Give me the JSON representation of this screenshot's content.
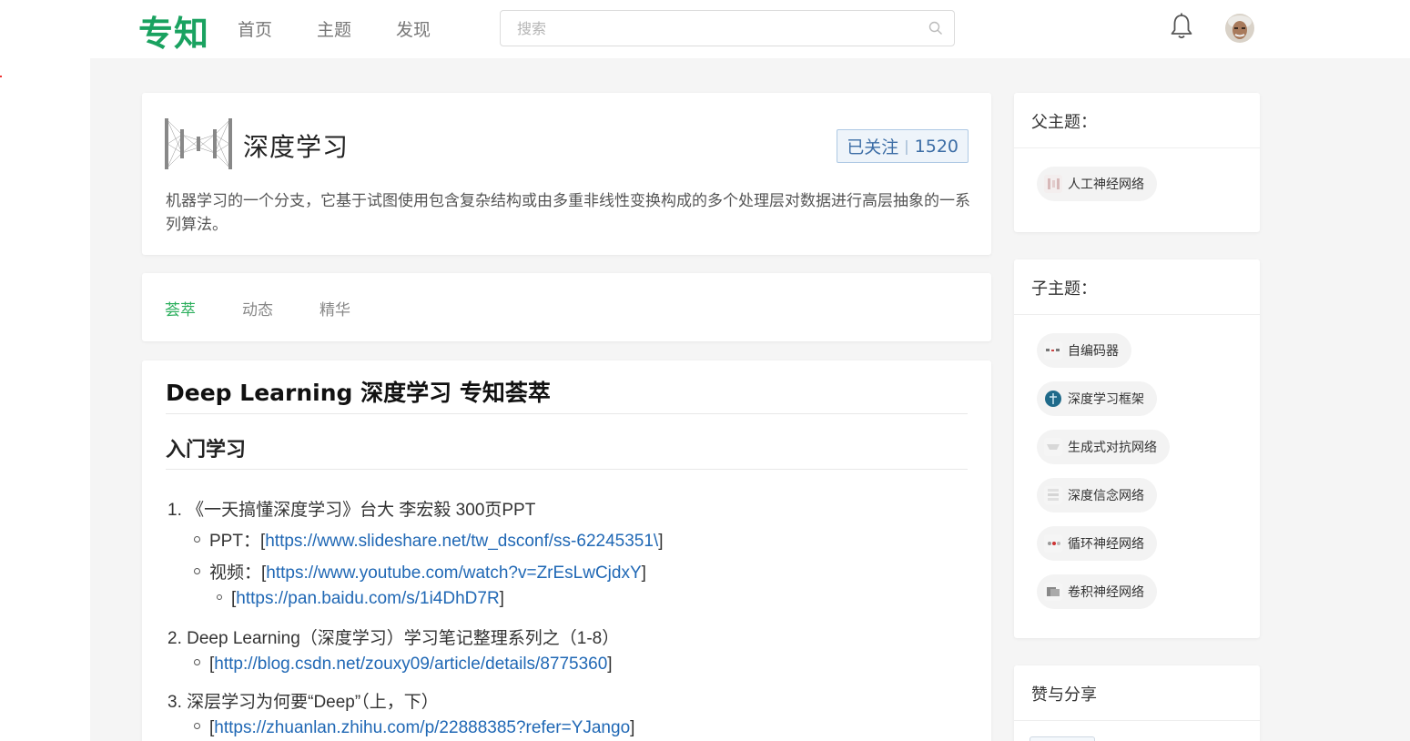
{
  "nav": {
    "logo": "专知",
    "links": [
      "首页",
      "主题",
      "发现"
    ],
    "search_placeholder": "搜索"
  },
  "topic": {
    "title": "深度学习",
    "follow_label": "已关注",
    "follow_count": "1520",
    "description": "机器学习的一个分支，它基于试图使用包含复杂结构或由多重非线性变换构成的多个处理层对数据进行高层抽象的一系列算法。"
  },
  "tabs": [
    "荟萃",
    "动态",
    "精华"
  ],
  "content": {
    "title": "Deep Learning 深度学习 专知荟萃",
    "section": "入门学习",
    "items": {
      "i1": "1. 《一天搞懂深度学习》台大 李宏毅 300页PPT",
      "i1_ppt_label": "PPT：[",
      "i1_ppt_link": "https://www.slideshare.net/tw_dsconf/ss-62245351\\",
      "i1_ppt_end": "]",
      "i1_video_label": "视频：[",
      "i1_video_link": "https://www.youtube.com/watch?v=ZrEsLwCjdxY",
      "i1_video_end": "]",
      "i1_pan_start": "[",
      "i1_pan_link": "https://pan.baidu.com/s/1i4DhD7R",
      "i1_pan_end": "]",
      "i2": "2. Deep Learning（深度学习）学习笔记整理系列之（1-8）",
      "i2_start": "[",
      "i2_link": "http://blog.csdn.net/zouxy09/article/details/8775360",
      "i2_end": "]",
      "i3": "3. 深层学习为何要“Deep”（上，下）",
      "i3_start": "[",
      "i3_link": "https://zhuanlan.zhihu.com/p/22888385?refer=YJango",
      "i3_end": "]"
    }
  },
  "sidebar": {
    "parent_title": "父主题：",
    "parents": [
      "人工神经网络"
    ],
    "child_title": "子主题：",
    "children": [
      "自编码器",
      "深度学习框架",
      "生成式对抗网络",
      "深度信念网络",
      "循环神经网络",
      "卷积神经网络"
    ],
    "share_title": "赞与分享"
  },
  "colors": {
    "brand": "#1aa260",
    "link": "#2068b5",
    "tab_active": "#2bae5c"
  }
}
